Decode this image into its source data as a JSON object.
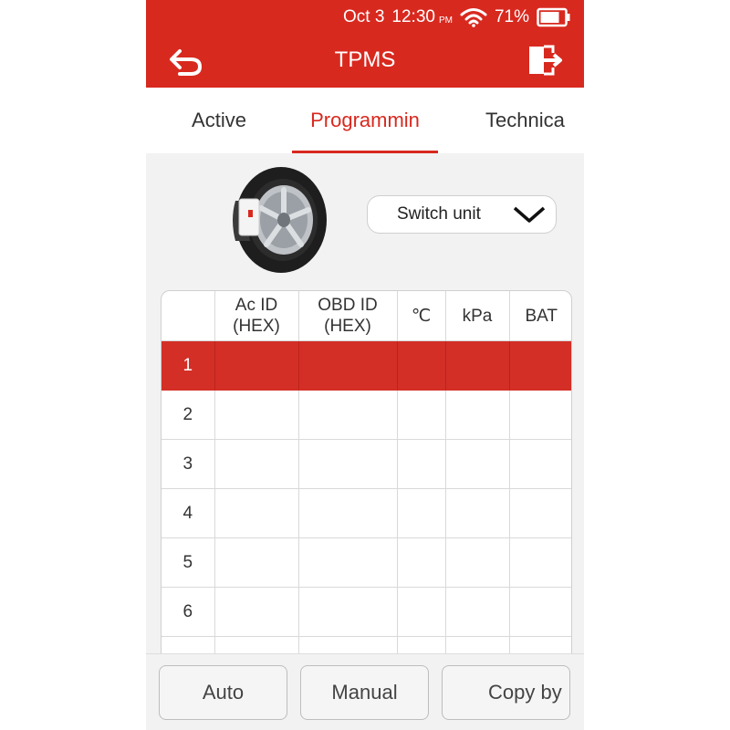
{
  "status": {
    "date": "Oct 3",
    "time": "12:30",
    "ampm": "PM",
    "battery": "71%"
  },
  "header": {
    "title": "TPMS",
    "back_icon": "back-arrow-icon",
    "exit_icon": "exit-icon"
  },
  "tabs": [
    {
      "label": "Active",
      "active": false
    },
    {
      "label": "Programmin",
      "active": true
    },
    {
      "label": "Technica",
      "active": false
    }
  ],
  "switch_unit": {
    "label": "Switch unit"
  },
  "table": {
    "headers": [
      "",
      "Ac ID\n(HEX)",
      "OBD ID\n(HEX)",
      "℃",
      "kPa",
      "BAT"
    ],
    "rows": [
      "1",
      "2",
      "3",
      "4",
      "5",
      "6",
      ""
    ],
    "selected_row": 0
  },
  "bottom": {
    "auto": "Auto",
    "manual": "Manual",
    "copy": "Copy by"
  },
  "colors": {
    "accent": "#d8291f",
    "background": "#f2f2f2"
  }
}
